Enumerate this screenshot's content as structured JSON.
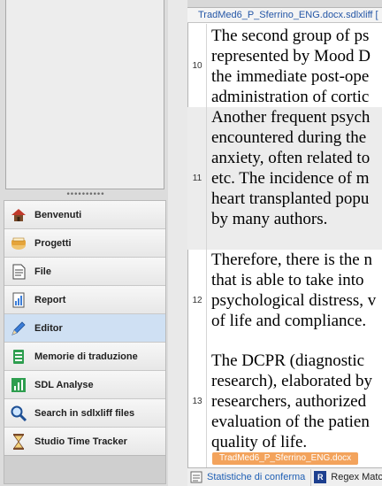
{
  "nav": {
    "items": [
      {
        "label": "Benvenuti",
        "icon": "home-icon"
      },
      {
        "label": "Progetti",
        "icon": "projects-icon"
      },
      {
        "label": "File",
        "icon": "file-icon"
      },
      {
        "label": "Report",
        "icon": "report-icon"
      },
      {
        "label": "Editor",
        "icon": "editor-pen-icon",
        "active": true
      },
      {
        "label": "Memorie di traduzione",
        "icon": "translation-memory-icon"
      },
      {
        "label": "SDL Analyse",
        "icon": "analyse-chart-icon"
      },
      {
        "label": "Search in sdlxliff files",
        "icon": "search-icon"
      },
      {
        "label": "Studio Time Tracker",
        "icon": "hourglass-icon"
      }
    ],
    "grip": "••••••••••"
  },
  "editor": {
    "file_tab": "TradMed6_P_Sferrino_ENG.docx.sdlxliff [",
    "end_tag": "TradMed6_P_Sferrino_ENG.docx",
    "segments": [
      {
        "num": "10",
        "lines": [
          "The second group of ps",
          "represented by Mood D",
          "the immediate post-ope",
          "administration of cortic"
        ]
      },
      {
        "num": "11",
        "lines": [
          "Another frequent psych",
          "encountered during the",
          "anxiety, often related to",
          "etc. The incidence of m",
          "heart transplanted popu",
          "by many authors."
        ]
      },
      {
        "num": "12",
        "lines": [
          "Therefore, there is the n",
          "that is able to take into",
          "psychological distress, v",
          "of life and compliance."
        ]
      },
      {
        "num": "13",
        "lines": [
          "The DCPR (diagnostic",
          "research), elaborated by",
          "researchers, authorized",
          "evaluation of the patien",
          "quality of life."
        ]
      }
    ]
  },
  "bottom_bar": {
    "stats_label": "Statistiche di conferma",
    "regex_label": "Regex Matc"
  },
  "colors": {
    "accent": "#2456a6",
    "active_nav": "#cfe0f3",
    "end_tag": "#f3a35c"
  }
}
